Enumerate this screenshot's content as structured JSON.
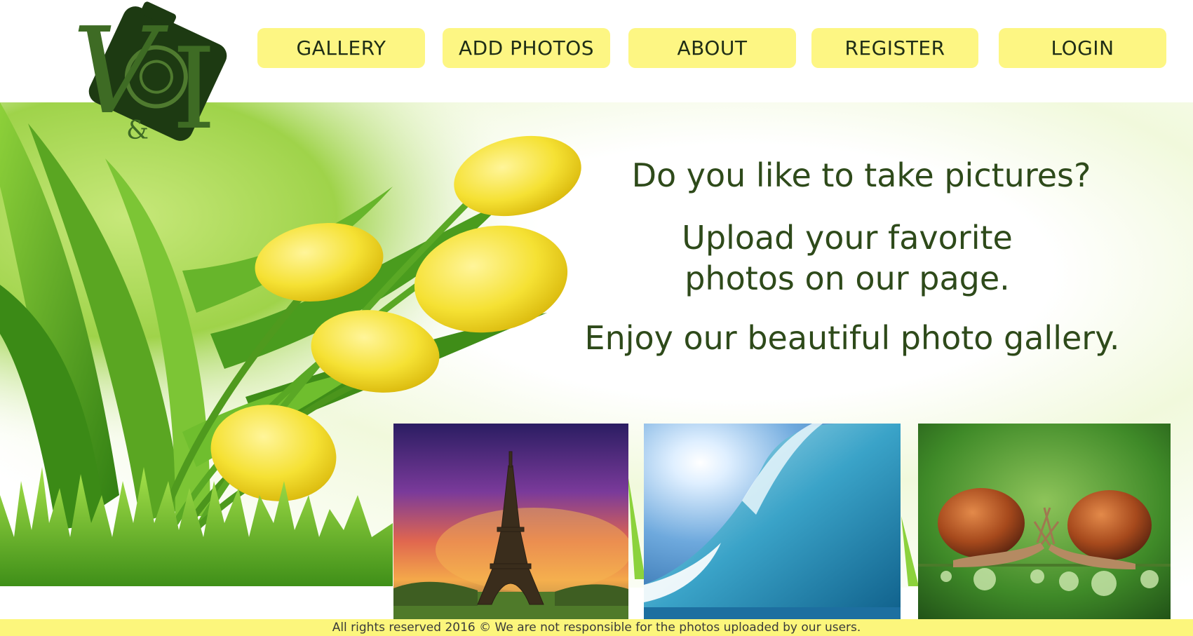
{
  "header": {
    "logo_icon": "camera-logo-icon",
    "nav": [
      {
        "label": "GALLERY"
      },
      {
        "label": "ADD PHOTOS"
      },
      {
        "label": "ABOUT"
      },
      {
        "label": "REGISTER"
      },
      {
        "label": "LOGIN"
      }
    ],
    "nav_color": "#fdf683"
  },
  "hero": {
    "line1": "Do you like to take pictures?",
    "line2a": "Upload your favorite",
    "line2b": "photos on our page.",
    "line3": "Enjoy our beautiful photo gallery.",
    "text_color": "#2e4a1a"
  },
  "gallery": {
    "thumbnails": [
      {
        "subject": "eiffel-tower-sunset"
      },
      {
        "subject": "ocean-wave"
      },
      {
        "subject": "snails-on-dewy-stem"
      }
    ]
  },
  "footer": {
    "text": "All rights reserved 2016 ©  We are not responsible for the photos uploaded by our users.",
    "color": "#fcf67c"
  }
}
